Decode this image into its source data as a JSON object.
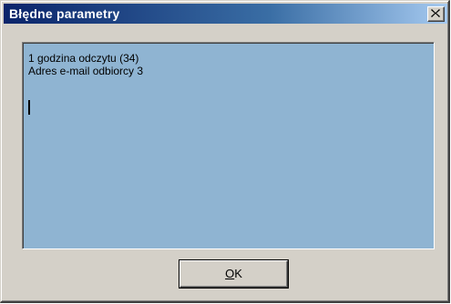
{
  "window": {
    "title": "Błędne parametry",
    "close_icon": "close-icon"
  },
  "message": {
    "lines": [
      "1 godzina odczytu (34)",
      "Adres e-mail odbiorcy 3"
    ],
    "background_color": "#8fb4d2"
  },
  "buttons": {
    "ok_mnemonic": "O",
    "ok_rest": "K"
  },
  "colors": {
    "titlebar_start": "#0a246a",
    "titlebar_end": "#a6caf0",
    "dialog_face": "#d4d0c8"
  }
}
